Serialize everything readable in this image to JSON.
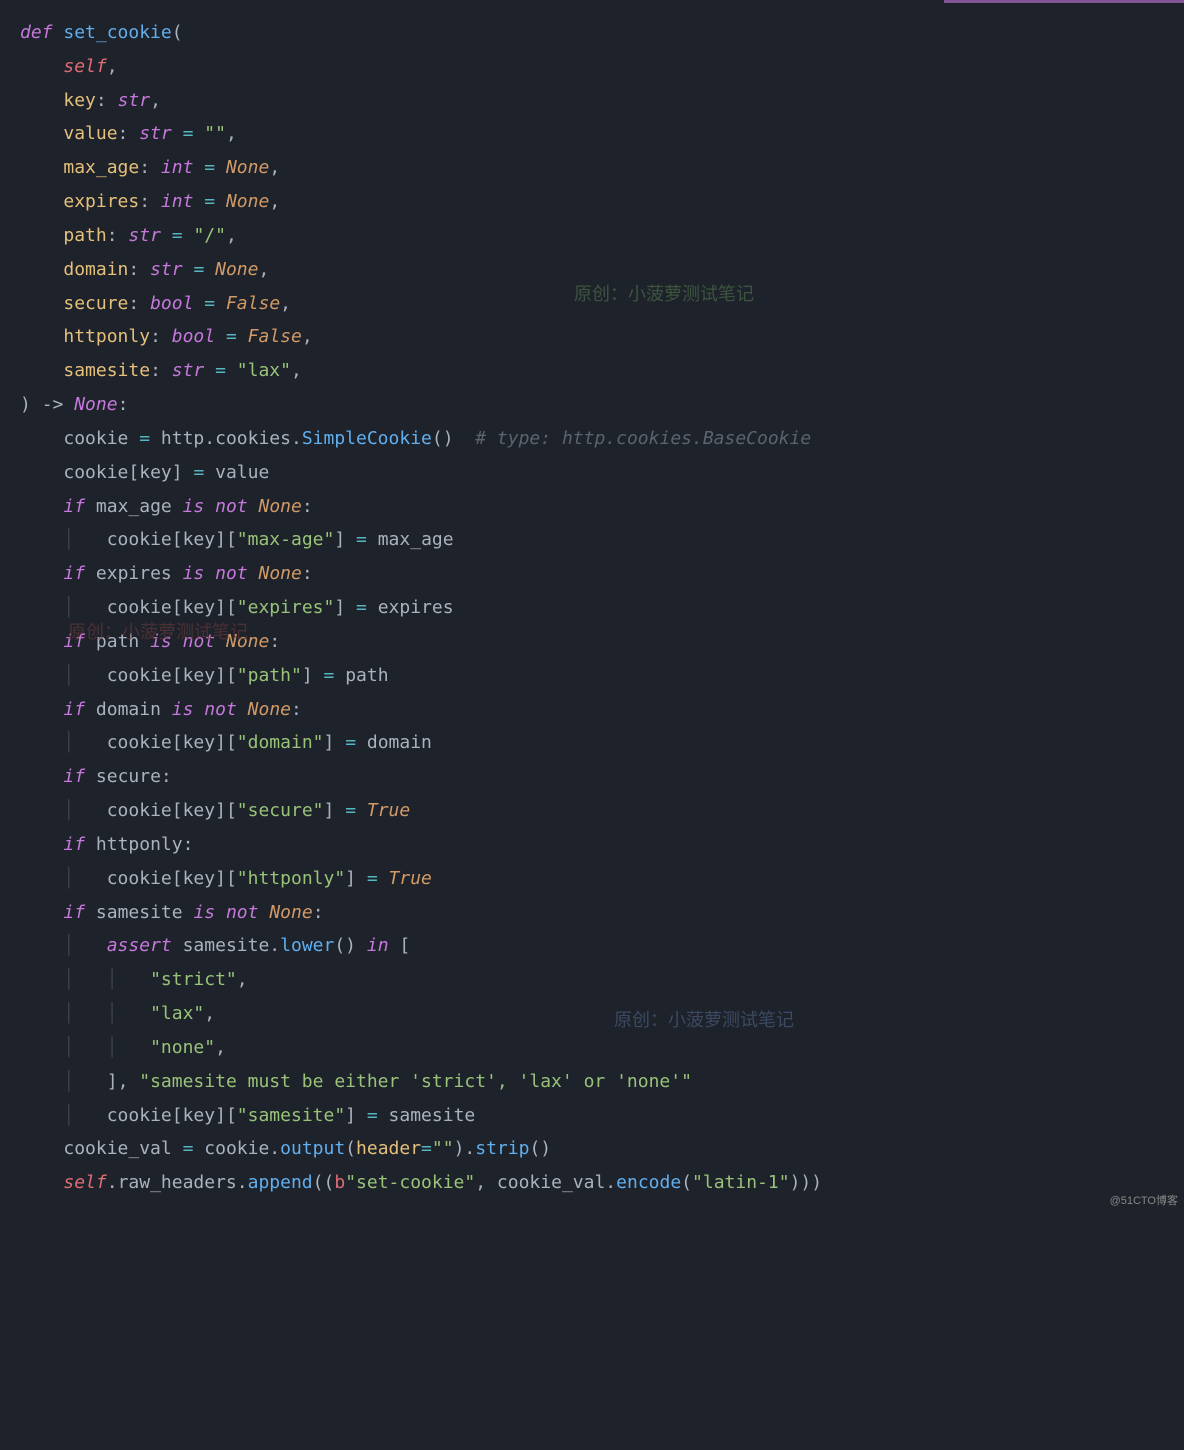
{
  "watermarks": {
    "w1": "原创：小菠萝测试笔记",
    "w2": "原创：小菠萝测试笔记",
    "w3": "原创：小菠萝测试笔记"
  },
  "footer": "@51CTO博客",
  "code": {
    "l1": {
      "def": "def",
      "fn": "set_cookie",
      "open": "("
    },
    "l2": {
      "self": "self",
      "comma": ","
    },
    "l3": {
      "p": "key",
      "colon": ":",
      "t": "str",
      "comma": ","
    },
    "l4": {
      "p": "value",
      "colon": ":",
      "t": "str",
      "eq": "=",
      "v": "\"\"",
      "comma": ","
    },
    "l5": {
      "p": "max_age",
      "colon": ":",
      "t": "int",
      "eq": "=",
      "v": "None",
      "comma": ","
    },
    "l6": {
      "p": "expires",
      "colon": ":",
      "t": "int",
      "eq": "=",
      "v": "None",
      "comma": ","
    },
    "l7": {
      "p": "path",
      "colon": ":",
      "t": "str",
      "eq": "=",
      "v": "\"/\"",
      "comma": ","
    },
    "l8": {
      "p": "domain",
      "colon": ":",
      "t": "str",
      "eq": "=",
      "v": "None",
      "comma": ","
    },
    "l9": {
      "p": "secure",
      "colon": ":",
      "t": "bool",
      "eq": "=",
      "v": "False",
      "comma": ","
    },
    "l10": {
      "p": "httponly",
      "colon": ":",
      "t": "bool",
      "eq": "=",
      "v": "False",
      "comma": ","
    },
    "l11": {
      "p": "samesite",
      "colon": ":",
      "t": "str",
      "eq": "=",
      "v": "\"lax\"",
      "comma": ","
    },
    "l12": {
      "close": ")",
      "arrow": "->",
      "ret": "None",
      "colon": ":"
    },
    "l13": {
      "a": "cookie",
      "eq": "=",
      "b": "http",
      "dot": ".",
      "c": "cookies",
      "dot2": ".",
      "d": "SimpleCookie",
      "paren": "()",
      "comment": "# type: http.cookies.BaseCookie"
    },
    "l14": {
      "a": "cookie",
      "br1": "[",
      "k": "key",
      "br2": "]",
      "eq": "=",
      "v": "value"
    },
    "l15": {
      "if": "if",
      "v": "max_age",
      "is": "is",
      "not": "not",
      "none": "None",
      "colon": ":"
    },
    "l16": {
      "a": "cookie",
      "br1": "[",
      "k": "key",
      "br2": "][",
      "s": "\"max-age\"",
      "br3": "]",
      "eq": "=",
      "v": "max_age"
    },
    "l17": {
      "if": "if",
      "v": "expires",
      "is": "is",
      "not": "not",
      "none": "None",
      "colon": ":"
    },
    "l18": {
      "a": "cookie",
      "br1": "[",
      "k": "key",
      "br2": "][",
      "s": "\"expires\"",
      "br3": "]",
      "eq": "=",
      "v": "expires"
    },
    "l19": {
      "if": "if",
      "v": "path",
      "is": "is",
      "not": "not",
      "none": "None",
      "colon": ":"
    },
    "l20": {
      "a": "cookie",
      "br1": "[",
      "k": "key",
      "br2": "][",
      "s": "\"path\"",
      "br3": "]",
      "eq": "=",
      "v": "path"
    },
    "l21": {
      "if": "if",
      "v": "domain",
      "is": "is",
      "not": "not",
      "none": "None",
      "colon": ":"
    },
    "l22": {
      "a": "cookie",
      "br1": "[",
      "k": "key",
      "br2": "][",
      "s": "\"domain\"",
      "br3": "]",
      "eq": "=",
      "v": "domain"
    },
    "l23": {
      "if": "if",
      "v": "secure",
      "colon": ":"
    },
    "l24": {
      "a": "cookie",
      "br1": "[",
      "k": "key",
      "br2": "][",
      "s": "\"secure\"",
      "br3": "]",
      "eq": "=",
      "v": "True"
    },
    "l25": {
      "if": "if",
      "v": "httponly",
      "colon": ":"
    },
    "l26": {
      "a": "cookie",
      "br1": "[",
      "k": "key",
      "br2": "][",
      "s": "\"httponly\"",
      "br3": "]",
      "eq": "=",
      "v": "True"
    },
    "l27": {
      "if": "if",
      "v": "samesite",
      "is": "is",
      "not": "not",
      "none": "None",
      "colon": ":"
    },
    "l28": {
      "assert": "assert",
      "v": "samesite",
      "dot": ".",
      "m": "lower",
      "paren": "()",
      "in": "in",
      "br": "["
    },
    "l29": {
      "s": "\"strict\"",
      "comma": ","
    },
    "l30": {
      "s": "\"lax\"",
      "comma": ","
    },
    "l31": {
      "s": "\"none\"",
      "comma": ","
    },
    "l32": {
      "br": "]",
      "comma": ",",
      "s": "\"samesite must be either 'strict', 'lax' or 'none'\""
    },
    "l33": {
      "a": "cookie",
      "br1": "[",
      "k": "key",
      "br2": "][",
      "s": "\"samesite\"",
      "br3": "]",
      "eq": "=",
      "v": "samesite"
    },
    "l34": {
      "a": "cookie_val",
      "eq": "=",
      "b": "cookie",
      "dot": ".",
      "m": "output",
      "paren": "(",
      "p": "header",
      "eq2": "=",
      "s": "\"\"",
      "paren2": ")",
      "dot2": ".",
      "m2": "strip",
      "paren3": "()"
    },
    "l35": {
      "self": "self",
      "dot": ".",
      "a": "raw_headers",
      "dot2": ".",
      "m": "append",
      "paren": "((",
      "b": "b",
      "s": "\"set-cookie\"",
      "comma": ",",
      "v": "cookie_val",
      "dot3": ".",
      "m2": "encode",
      "paren2": "(",
      "s2": "\"latin-1\"",
      "paren3": ")))"
    }
  }
}
